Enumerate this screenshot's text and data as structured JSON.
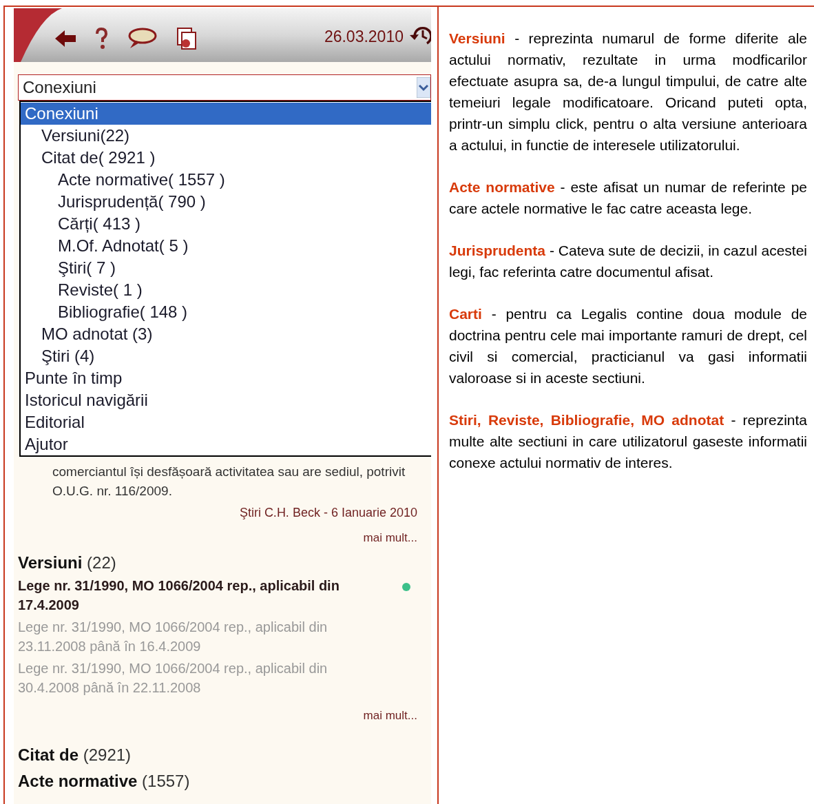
{
  "toolbar": {
    "date": "26.03.2010"
  },
  "select": {
    "value": "Conexiuni"
  },
  "dropdown": [
    {
      "label": "Conexiuni",
      "selected": true,
      "children": [
        {
          "label": "Versiuni(22)",
          "selected": false
        },
        {
          "label": "Citat de( 2921 )",
          "selected": false,
          "children": [
            {
              "label": "Acte normative( 1557 )",
              "selected": false
            },
            {
              "label": "Jurisprudență( 790 )",
              "selected": false
            },
            {
              "label": "Cărți( 413 )",
              "selected": false
            },
            {
              "label": "M.Of. Adnotat( 5 )",
              "selected": false
            },
            {
              "label": "Ştiri( 7 )",
              "selected": false
            },
            {
              "label": "Reviste( 1 )",
              "selected": false
            },
            {
              "label": "Bibliografie( 148 )",
              "selected": false
            }
          ]
        },
        {
          "label": "MO adnotat (3)",
          "selected": false
        },
        {
          "label": "Ştiri (4)",
          "selected": false
        }
      ]
    },
    {
      "label": "Punte în timp",
      "selected": false
    },
    {
      "label": "Istoricul navigării",
      "selected": false
    },
    {
      "label": "Editorial",
      "selected": false
    },
    {
      "label": "Ajutor",
      "selected": false
    }
  ],
  "news": {
    "text": "comerciantul își desfășoară activitatea sau are sediul, potrivit O.U.G. nr. 116/2009.",
    "source": "Ştiri C.H. Beck - 6 Ianuarie 2010",
    "more": "mai mult..."
  },
  "versions": {
    "title": "Versiuni",
    "count": "(22)",
    "items": [
      {
        "text": "Lege nr. 31/1990, MO 1066/2004 rep., aplicabil din 17.4.2009",
        "current": true,
        "color": "#3cc08a"
      },
      {
        "text": "Lege nr. 31/1990, MO 1066/2004 rep., aplicabil din 23.11.2008 până în 16.4.2009",
        "current": false
      },
      {
        "text": "Lege nr. 31/1990, MO 1066/2004 rep., aplicabil din 30.4.2008 până în 22.11.2008",
        "current": false
      }
    ],
    "more": "mai mult..."
  },
  "cited_by": {
    "title": "Citat de",
    "count": "(2921)"
  },
  "acts": {
    "title": "Acte normative",
    "count": "(1557)"
  },
  "explanations": [
    {
      "term": "Versiuni",
      "text": "- reprezinta numarul de forme diferite ale actului normativ, rezultate in urma modficarilor efectuate asupra sa, de-a lungul timpului, de catre alte temeiuri legale modificatoare. Oricand puteti opta, printr-un simplu click, pentru o alta versiune anterioara a actului, in functie de interesele utilizatorului."
    },
    {
      "term": "Acte normative",
      "text": "- este afisat un numar de referinte pe care actele normative le fac catre aceasta lege."
    },
    {
      "term": "Jurisprudenta",
      "text": "- Cateva sute de decizii, in cazul acestei legi, fac referinta catre documentul afisat."
    },
    {
      "term": "Carti",
      "text": "- pentru ca Legalis contine doua module de doctrina pentru cele mai importante ramuri de drept, cel civil si comercial, practicianul va gasi informatii valoroase si in aceste sectiuni."
    },
    {
      "term": "Stiri, Reviste, Bibliografie, MO adnotat",
      "text": "- reprezinta multe alte sectiuni in care utilizatorul gaseste informatii conexe actului normativ de interes."
    }
  ]
}
